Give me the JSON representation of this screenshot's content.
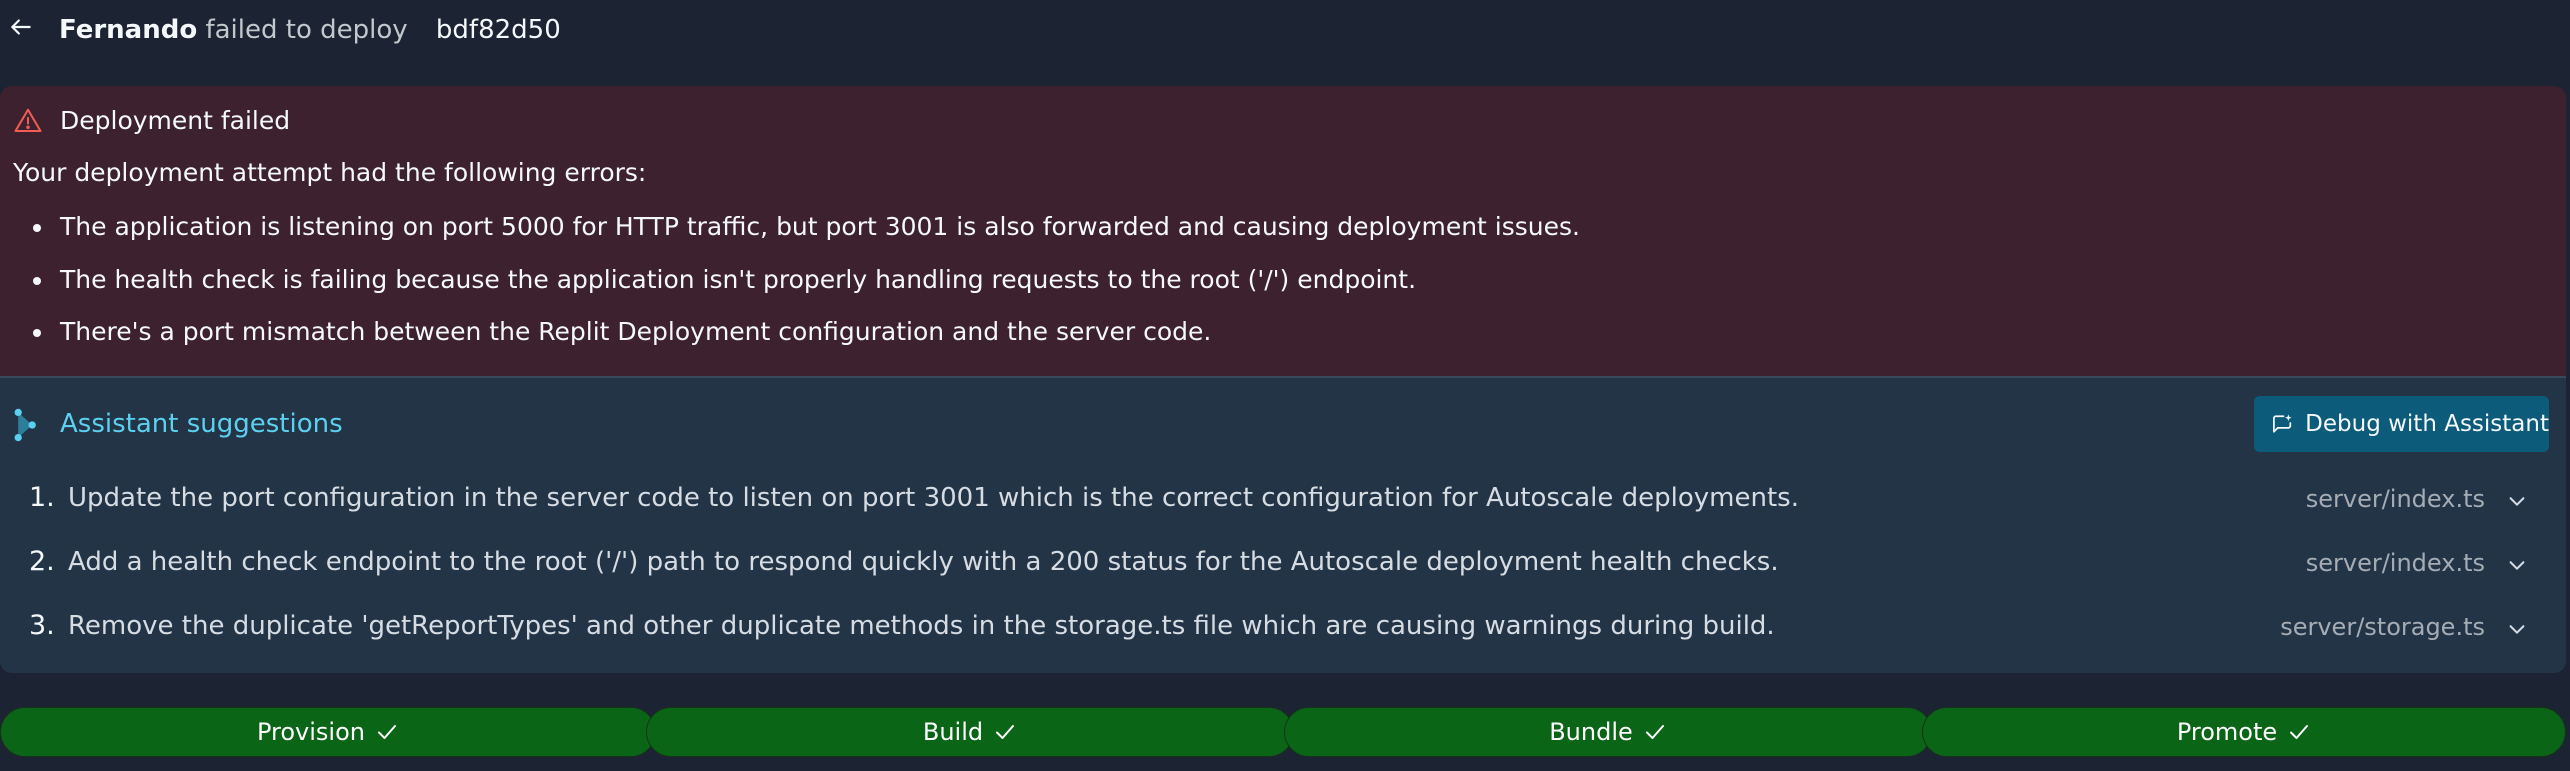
{
  "header": {
    "user": "Fernando",
    "action": "failed to deploy",
    "commit": "bdf82d50"
  },
  "error": {
    "title": "Deployment failed",
    "intro": "Your deployment attempt had the following errors:",
    "items": [
      "The application is listening on port 5000 for HTTP traffic, but port 3001 is also forwarded and causing deployment issues.",
      "The health check is failing because the application isn't properly handling requests to the root ('/') endpoint.",
      "There's a port mismatch between the Replit Deployment configuration and the server code."
    ]
  },
  "assistant": {
    "title": "Assistant suggestions",
    "debug_label": "Debug with Assistant",
    "suggestions": [
      {
        "num": "1.",
        "text": "Update the port configuration in the server code to listen on port 3001 which is the correct configuration for Autoscale deployments.",
        "file": "server/index.ts"
      },
      {
        "num": "2.",
        "text": "Add a health check endpoint to the root ('/') path to respond quickly with a 200 status for the Autoscale deployment health checks.",
        "file": "server/index.ts"
      },
      {
        "num": "3.",
        "text": "Remove the duplicate 'getReportTypes' and other duplicate methods in the storage.ts file which are causing warnings during build.",
        "file": "server/storage.ts"
      }
    ]
  },
  "steps": [
    {
      "label": "Provision",
      "status": "complete"
    },
    {
      "label": "Build",
      "status": "complete"
    },
    {
      "label": "Bundle",
      "status": "complete"
    },
    {
      "label": "Promote",
      "status": "complete"
    }
  ],
  "colors": {
    "background": "#1c2333",
    "error_panel": "#3d212f",
    "assist_panel": "#243447",
    "accent": "#5bd1ef",
    "success": "#0a6516",
    "debug_button": "#0c5b7a",
    "alert": "#f25c54"
  }
}
